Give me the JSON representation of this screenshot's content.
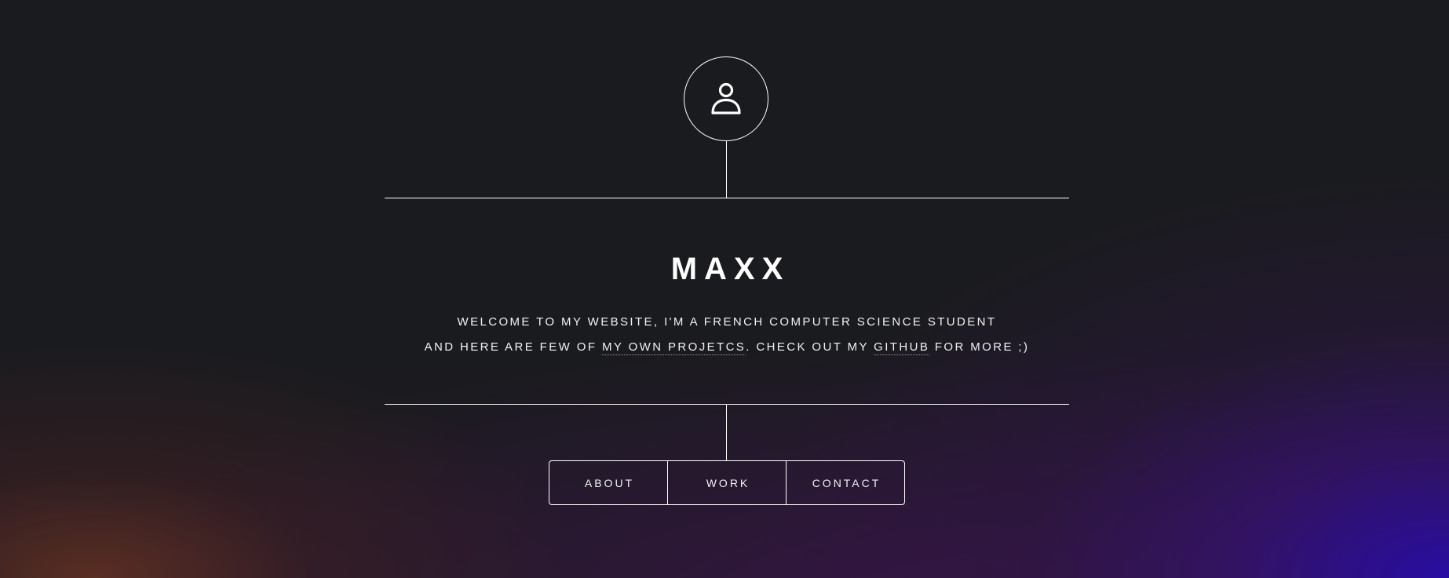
{
  "header": {
    "logo_icon": "user-icon",
    "title": "MAXX",
    "intro": {
      "line1": "WELCOME TO MY WEBSITE, I'M A FRENCH COMPUTER SCIENCE STUDENT",
      "line2_before": "AND HERE ARE FEW OF ",
      "projects_link": "MY OWN PROJETCS",
      "line2_middle": ". CHECK OUT MY ",
      "github_link": "GITHUB",
      "line2_after": " FOR MORE ;)"
    },
    "nav": [
      {
        "label": "ABOUT"
      },
      {
        "label": "WORK"
      },
      {
        "label": "CONTACT"
      }
    ]
  },
  "colors": {
    "background": "#1a1b1e",
    "foreground": "#ffffff",
    "glow_blue": "#2810aa",
    "glow_orange": "#6e3424"
  }
}
